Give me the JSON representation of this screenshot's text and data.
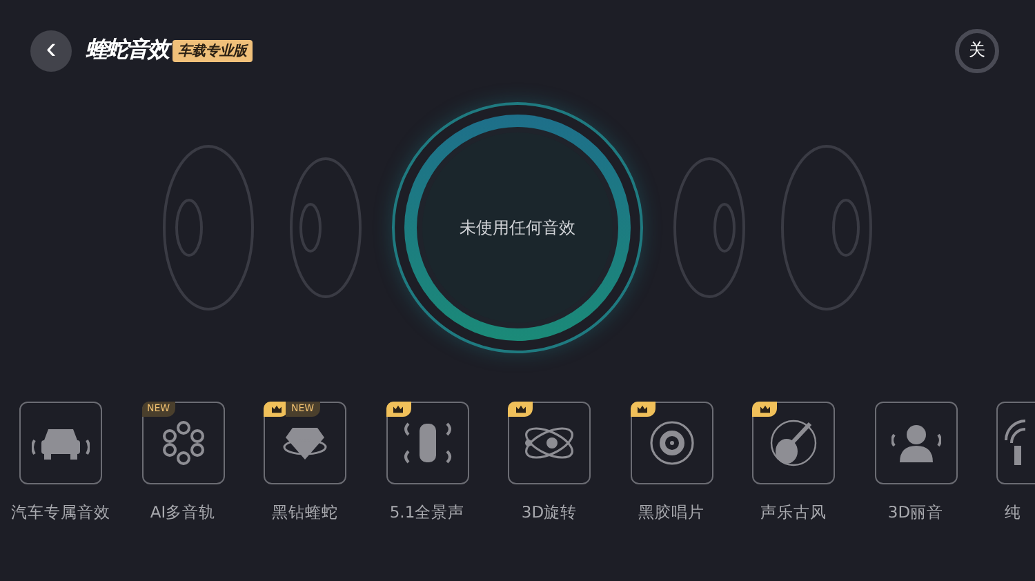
{
  "header": {
    "back": "‹",
    "logo": "蝰蛇音效",
    "edition": "车载专业版",
    "power": "关"
  },
  "status": {
    "text": "未使用任何音效"
  },
  "effects": [
    {
      "label": "汽车专属音效",
      "vip": false
    },
    {
      "label": "AI多音轨",
      "vip": false,
      "badge": "NEW"
    },
    {
      "label": "黑钻蝰蛇",
      "vip": true,
      "badge": "NEW"
    },
    {
      "label": "5.1全景声",
      "vip": true
    },
    {
      "label": "3D旋转",
      "vip": true
    },
    {
      "label": "黑胶唱片",
      "vip": true
    },
    {
      "label": "声乐古风",
      "vip": true
    },
    {
      "label": "3D丽音",
      "vip": false
    },
    {
      "label": "纯",
      "vip": false
    }
  ]
}
